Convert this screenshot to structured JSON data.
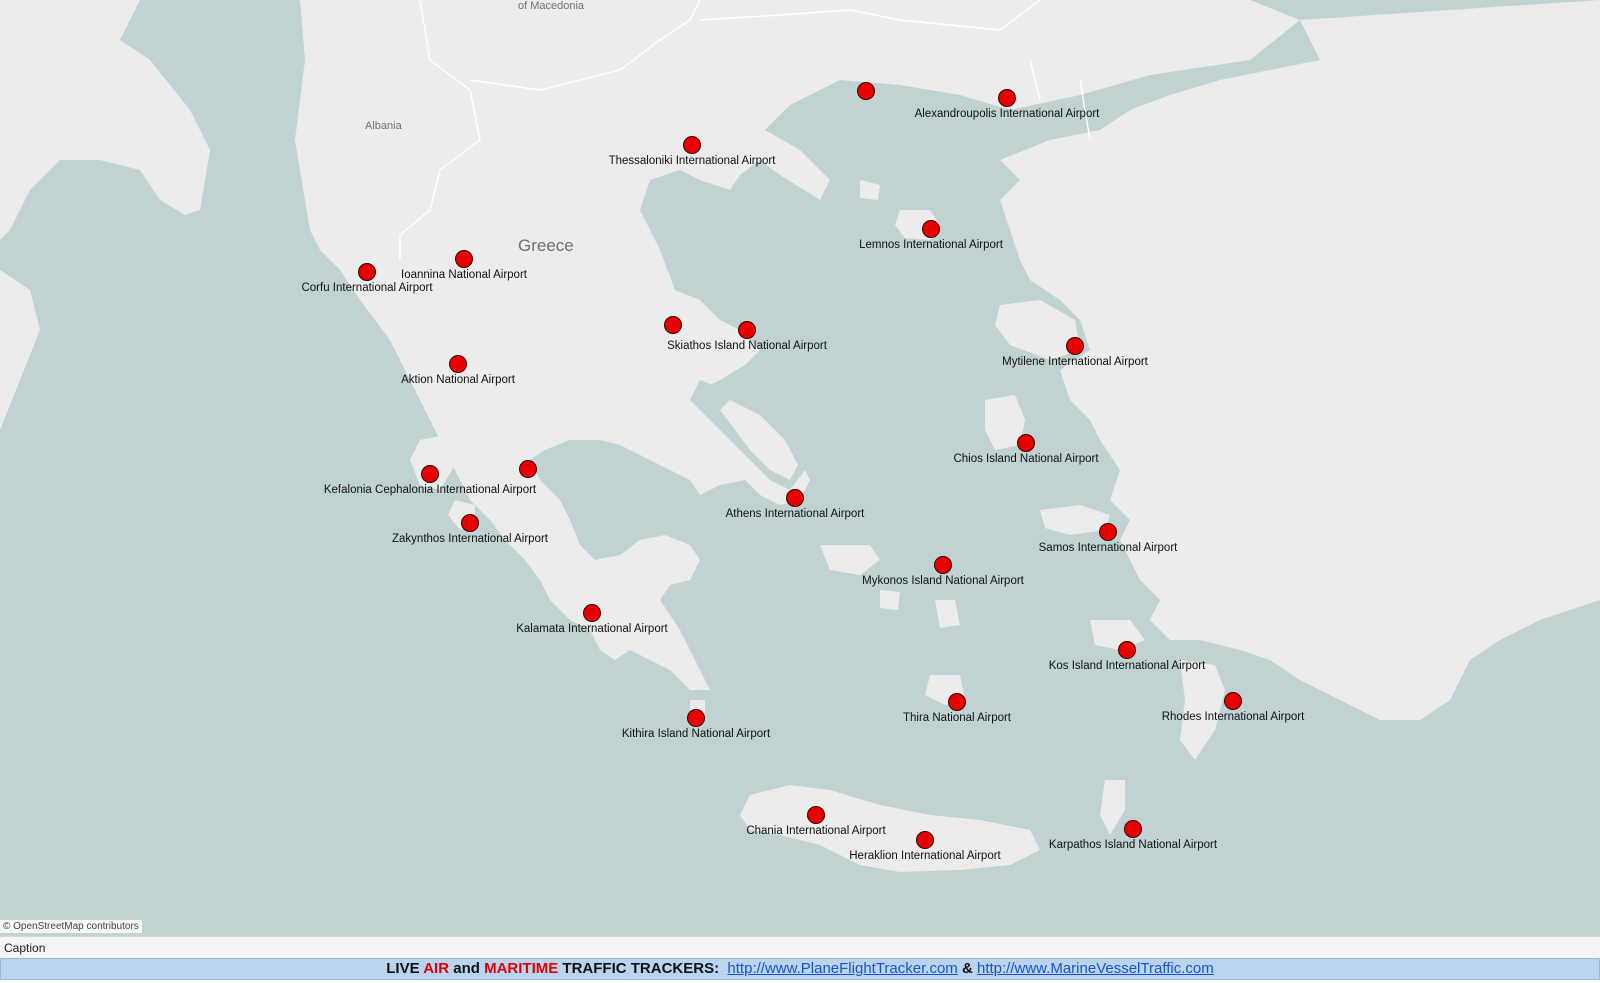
{
  "map": {
    "attribution": "© OpenStreetMap contributors",
    "colors": {
      "sea": "#c0d3d2",
      "land": "#ececec",
      "border": "#ffffff",
      "marker": "#e80000"
    },
    "place_labels": {
      "macedonia": "of Macedonia",
      "albania": "Albania",
      "greece": "Greece"
    },
    "airports": [
      {
        "name": "Alexandroupolis International Airport"
      },
      {
        "name": "Thessaloniki International Airport"
      },
      {
        "name": "Lemnos International Airport"
      },
      {
        "name": "Ioannina National Airport"
      },
      {
        "name": "Corfu International Airport"
      },
      {
        "name": "Skiathos Island National Airport"
      },
      {
        "name": "Mytilene International Airport"
      },
      {
        "name": "Aktion National Airport"
      },
      {
        "name": "Chios Island National Airport"
      },
      {
        "name": "Kefalonia Cephalonia International Airport"
      },
      {
        "name": "Athens International Airport"
      },
      {
        "name": "Samos International Airport"
      },
      {
        "name": "Zakynthos International Airport"
      },
      {
        "name": "Mykonos Island National Airport"
      },
      {
        "name": "Kalamata International Airport"
      },
      {
        "name": "Kos Island International Airport"
      },
      {
        "name": "Thira National Airport"
      },
      {
        "name": "Rhodes International Airport"
      },
      {
        "name": "Kithira Island National Airport"
      },
      {
        "name": "Chania International Airport"
      },
      {
        "name": "Heraklion International Airport"
      },
      {
        "name": "Karpathos Island National Airport"
      },
      {
        "name": ""
      },
      {
        "name": ""
      },
      {
        "name": ""
      }
    ]
  },
  "caption": {
    "title": "Caption"
  },
  "footer": {
    "live": "LIVE",
    "air": "AIR",
    "and": "and",
    "maritime": "MARITIME",
    "traffic": "TRAFFIC TRACKERS:",
    "link1": "http://www.PlaneFlightTracker.com",
    "amp": "&",
    "link2": "http://www.MarineVesselTraffic.com"
  }
}
